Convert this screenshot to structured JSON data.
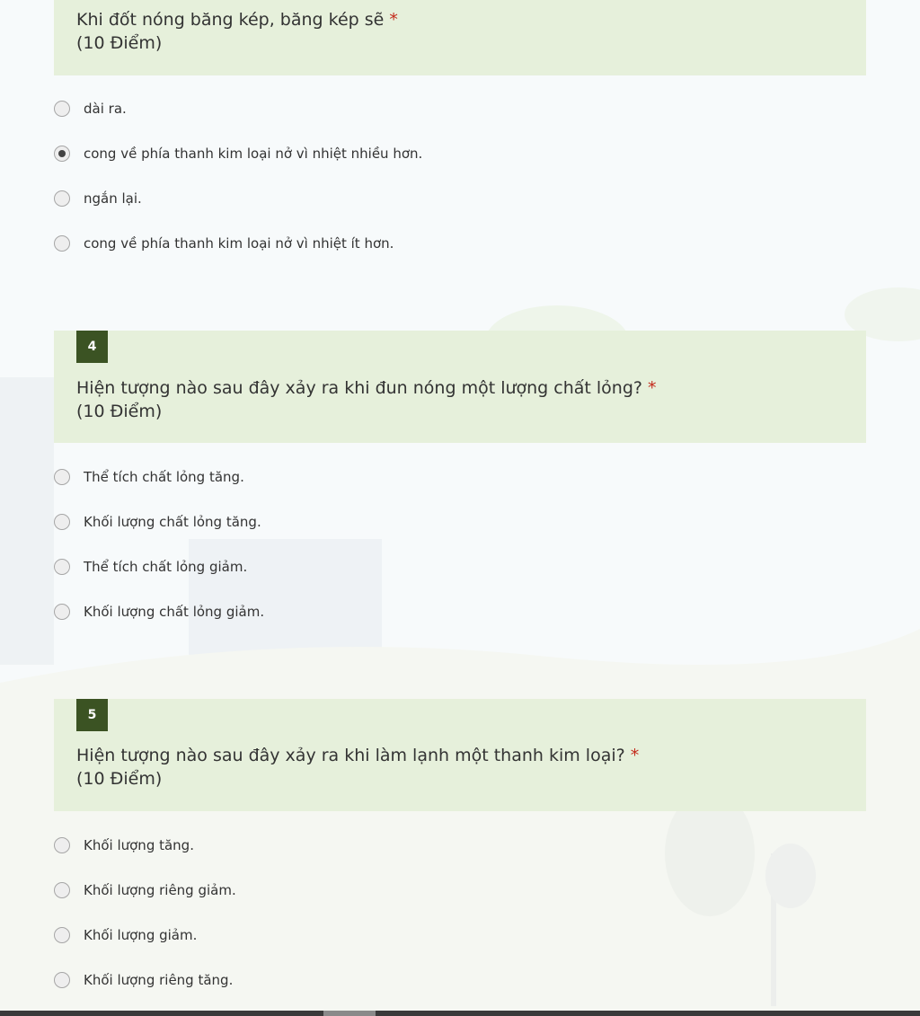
{
  "required_marker": "*",
  "questions": [
    {
      "number": "",
      "title": "Khi đốt nóng băng kép, băng kép sẽ",
      "points": "(10 Điểm)",
      "options": [
        {
          "label": "dài ra.",
          "checked": false
        },
        {
          "label": "cong về phía thanh kim loại nở vì nhiệt nhiều hơn.",
          "checked": true
        },
        {
          "label": "ngắn lại.",
          "checked": false
        },
        {
          "label": "cong về phía thanh kim loại nở vì nhiệt ít hơn.",
          "checked": false
        }
      ]
    },
    {
      "number": "4",
      "title": "Hiện tượng nào sau đây xảy ra khi đun nóng một lượng chất lỏng?",
      "points": "(10 Điểm)",
      "options": [
        {
          "label": "Thể tích chất lỏng tăng.",
          "checked": false
        },
        {
          "label": "Khối lượng chất lỏng tăng.",
          "checked": false
        },
        {
          "label": "Thể tích chất lỏng giảm.",
          "checked": false
        },
        {
          "label": "Khối lượng chất lỏng giảm.",
          "checked": false
        }
      ]
    },
    {
      "number": "5",
      "title": "Hiện tượng nào sau đây xảy ra khi làm lạnh một thanh kim loại?",
      "points": "(10 Điểm)",
      "options": [
        {
          "label": "Khối lượng tăng.",
          "checked": false
        },
        {
          "label": "Khối lượng riêng giảm.",
          "checked": false
        },
        {
          "label": "Khối lượng giảm.",
          "checked": false
        },
        {
          "label": "Khối lượng riêng tăng.",
          "checked": false
        }
      ]
    }
  ],
  "colors": {
    "header_bg": "#e6f0db",
    "number_badge": "#3b5323",
    "required": "#c42b1c",
    "page_bg": "#f7fafb"
  }
}
